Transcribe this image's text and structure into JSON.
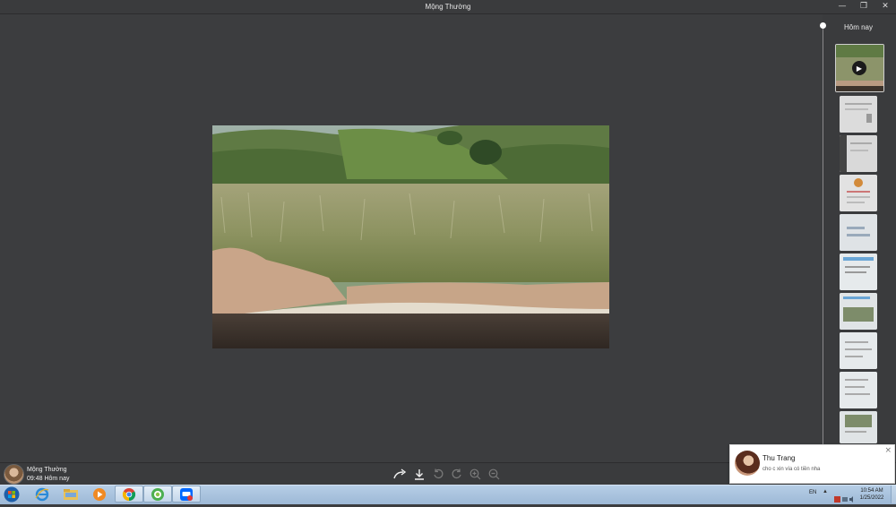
{
  "window": {
    "title": "Mộng Thường",
    "controls": {
      "minimize": "—",
      "restore": "❐",
      "close": "✕"
    }
  },
  "sidebar": {
    "date_label": "Hôm nay",
    "thumbnails": [
      {
        "kind": "video",
        "selected": true
      },
      {
        "kind": "document"
      },
      {
        "kind": "document"
      },
      {
        "kind": "document"
      },
      {
        "kind": "screenshot"
      },
      {
        "kind": "screenshot"
      },
      {
        "kind": "screenshot"
      },
      {
        "kind": "screenshot"
      },
      {
        "kind": "screenshot"
      },
      {
        "kind": "screenshot"
      }
    ]
  },
  "footer": {
    "sender_name": "Mộng Thường",
    "sent_time": "09:48 Hôm nay",
    "toolbar": [
      "share-icon",
      "download-icon",
      "rotate-left-icon",
      "rotate-right-icon",
      "zoom-in-icon",
      "zoom-out-icon"
    ]
  },
  "notification": {
    "name": "Thu Trang",
    "message": "cho c xin vía có tiền nha",
    "close": "×"
  },
  "taskbar": {
    "apps": [
      "start-orb",
      "internet-explorer",
      "file-explorer",
      "media-player",
      "chrome",
      "green-app",
      "zalo"
    ],
    "language": "EN",
    "tray_arrow": "▲",
    "time": "10:54 AM",
    "date": "1/25/2022"
  }
}
